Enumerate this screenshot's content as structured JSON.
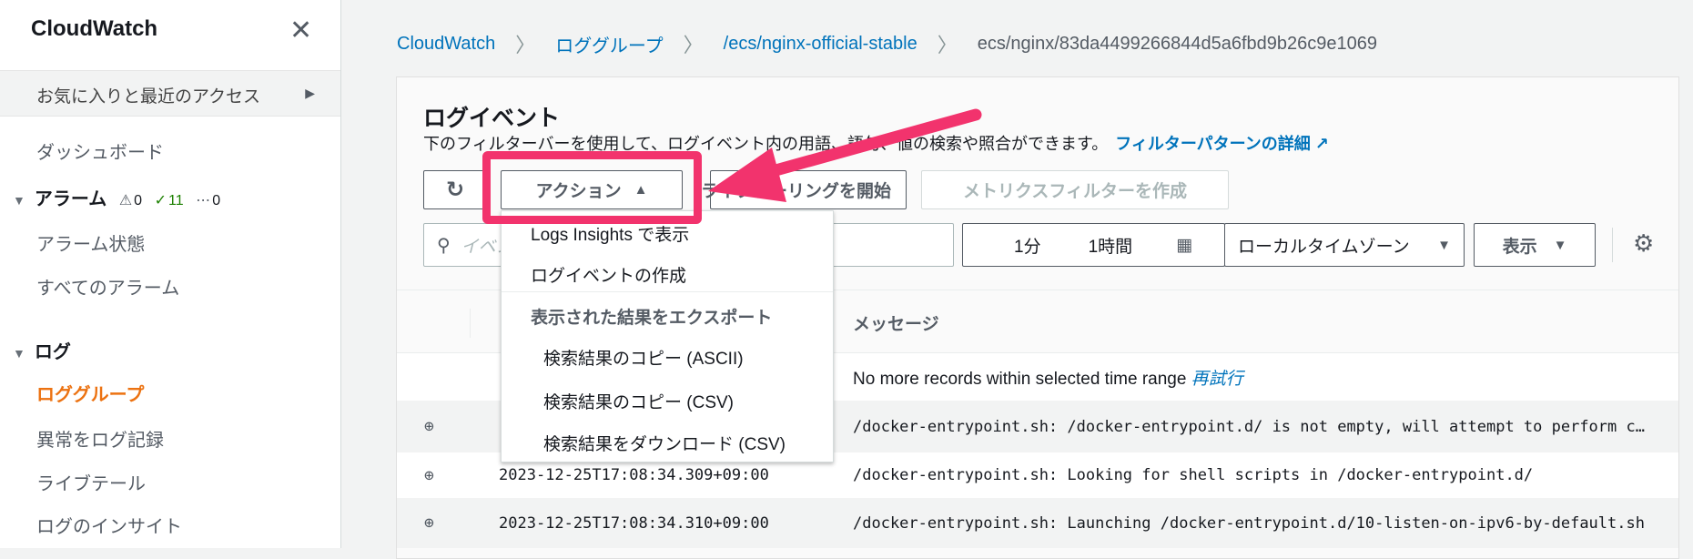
{
  "sidebar": {
    "title": "CloudWatch",
    "favorites": "お気に入りと最近のアクセス",
    "dashboard": "ダッシュボード",
    "alarms": {
      "label": "アラーム",
      "alarm_count": "0",
      "ok_count": "11",
      "insufficient_count": "0"
    },
    "alarm_state": "アラーム状態",
    "all_alarms": "すべてのアラーム",
    "logs": "ログ",
    "log_groups": "ロググループ",
    "anomaly": "異常をログ記録",
    "live_tail": "ライブテール",
    "insights": "ログのインサイト"
  },
  "breadcrumb": [
    "CloudWatch",
    "ロググループ",
    "/ecs/nginx-official-stable",
    "ecs/nginx/83da4499266844d5a6fbd9b26c9e1069"
  ],
  "panel": {
    "title": "ログイベント",
    "description": "下のフィルターバーを使用して、ログイベント内の用語、語句、値の検索や照合ができます。",
    "learn_more": "フィルターパターンの詳細",
    "actions_label": "アクション",
    "live_tail_label": "ライブテーリングを開始",
    "metric_filter_label": "メトリクスフィルターを作成",
    "search_placeholder": "イベントをフィルター",
    "time_1m": "1分",
    "time_1h": "1時間",
    "timezone": "ローカルタイムゾーン",
    "display": "表示",
    "message_header": "メッセージ",
    "no_more": "No more records within selected time range",
    "retry": "再試行"
  },
  "rows": [
    {
      "timestamp": "",
      "message": "/docker-entrypoint.sh: /docker-entrypoint.d/ is not empty, will attempt to perform configuration"
    },
    {
      "timestamp": "2023-12-25T17:08:34.309+09:00",
      "message": "/docker-entrypoint.sh: Looking for shell scripts in /docker-entrypoint.d/"
    },
    {
      "timestamp": "2023-12-25T17:08:34.310+09:00",
      "message": "/docker-entrypoint.sh: Launching /docker-entrypoint.d/10-listen-on-ipv6-by-default.sh"
    }
  ],
  "dropdown": {
    "logs_insights": "Logs Insights で表示",
    "create_event": "ログイベントの作成",
    "export_header": "表示された結果をエクスポート",
    "copy_ascii": "検索結果のコピー (ASCII)",
    "copy_csv": "検索結果のコピー (CSV)",
    "download_csv": "検索結果をダウンロード (CSV)"
  },
  "colors": {
    "link": "#0073bb",
    "active": "#ec7211",
    "highlight": "#f2336d",
    "ok": "#1d8102"
  }
}
